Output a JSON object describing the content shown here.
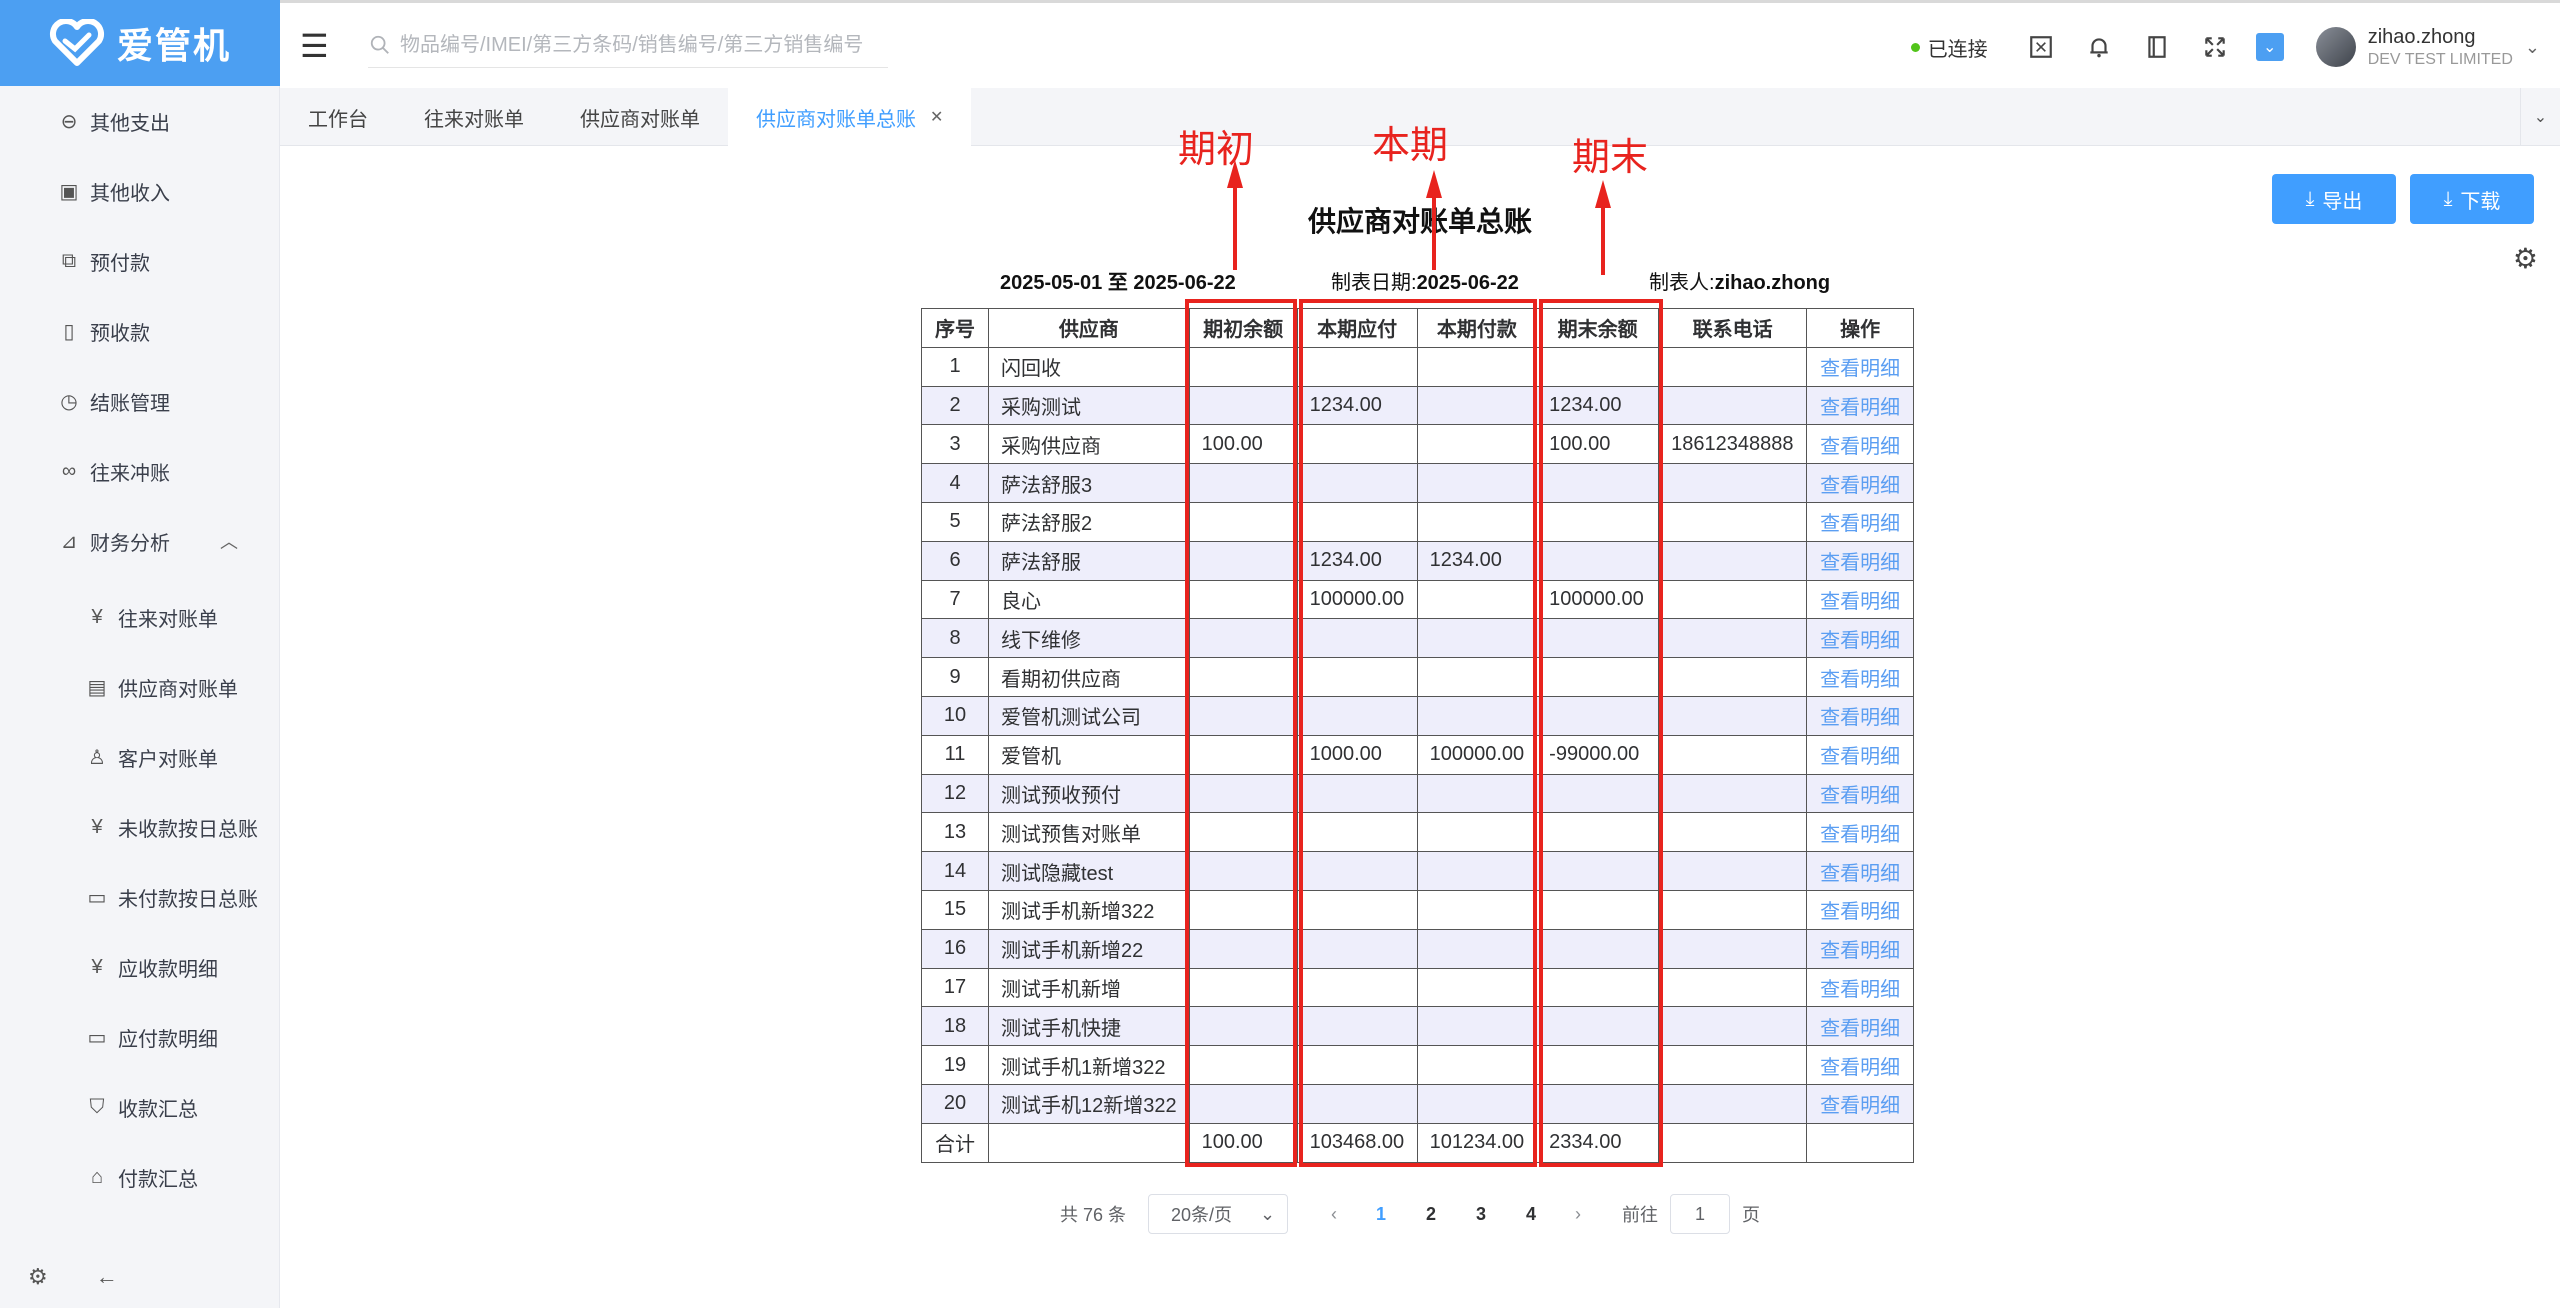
{
  "app": {
    "name": "爱管机"
  },
  "sidebar": {
    "items": [
      {
        "label": "其他支出",
        "icon": "coin-circle-icon"
      },
      {
        "label": "其他收入",
        "icon": "income-receipt-icon"
      },
      {
        "label": "预付款",
        "icon": "prepay-icon"
      },
      {
        "label": "预收款",
        "icon": "document-icon"
      },
      {
        "label": "结账管理",
        "icon": "history-clock-icon"
      },
      {
        "label": "往来冲账",
        "icon": "link-icon"
      },
      {
        "label": "财务分析",
        "icon": "chart-icon",
        "expanded": true
      }
    ],
    "subitems": [
      {
        "label": "往来对账单",
        "icon": "yen-doc-icon"
      },
      {
        "label": "供应商对账单",
        "icon": "doc-list-icon"
      },
      {
        "label": "客户对账单",
        "icon": "user-doc-icon"
      },
      {
        "label": "未收款按日总账",
        "icon": "yen-doc-icon"
      },
      {
        "label": "未付款按日总账",
        "icon": "wallet-icon"
      },
      {
        "label": "应收款明细",
        "icon": "yen-doc-icon"
      },
      {
        "label": "应付款明细",
        "icon": "card-icon"
      },
      {
        "label": "收款汇总",
        "icon": "shield-yen-icon"
      },
      {
        "label": "付款汇总",
        "icon": "home-yen-icon"
      }
    ]
  },
  "header": {
    "search_placeholder": "物品编号/IMEI/第三方条码/销售编号/第三方销售编号",
    "status": "已连接",
    "user_name": "zihao.zhong",
    "company": "DEV TEST LIMITED"
  },
  "tabs": [
    {
      "label": "工作台",
      "active": false
    },
    {
      "label": "往来对账单",
      "active": false
    },
    {
      "label": "供应商对账单",
      "active": false
    },
    {
      "label": "供应商对账单总账",
      "active": true
    }
  ],
  "toolbar": {
    "export_label": "导出",
    "download_label": "下载"
  },
  "report": {
    "title": "供应商对账单总账",
    "date_range": "2025-05-01 至 2025-06-22",
    "made_date_label": "制表日期:",
    "made_date": "2025-06-22",
    "maker_label": "制表人:",
    "maker": "zihao.zhong",
    "columns": [
      "序号",
      "供应商",
      "期初余额",
      "本期应付",
      "本期付款",
      "期末余额",
      "联系电话",
      "操作"
    ],
    "rows": [
      [
        "1",
        "闪回收",
        "",
        "",
        "",
        "",
        "",
        "查看明细"
      ],
      [
        "2",
        "采购测试",
        "",
        "1234.00",
        "",
        "1234.00",
        "",
        "查看明细"
      ],
      [
        "3",
        "采购供应商",
        "100.00",
        "",
        "",
        "100.00",
        "18612348888",
        "查看明细"
      ],
      [
        "4",
        "萨法舒服3",
        "",
        "",
        "",
        "",
        "",
        "查看明细"
      ],
      [
        "5",
        "萨法舒服2",
        "",
        "",
        "",
        "",
        "",
        "查看明细"
      ],
      [
        "6",
        "萨法舒服",
        "",
        "1234.00",
        "1234.00",
        "",
        "",
        "查看明细"
      ],
      [
        "7",
        "良心",
        "",
        "100000.00",
        "",
        "100000.00",
        "",
        "查看明细"
      ],
      [
        "8",
        "线下维修",
        "",
        "",
        "",
        "",
        "",
        "查看明细"
      ],
      [
        "9",
        "看期初供应商",
        "",
        "",
        "",
        "",
        "",
        "查看明细"
      ],
      [
        "10",
        "爱管机测试公司",
        "",
        "",
        "",
        "",
        "",
        "查看明细"
      ],
      [
        "11",
        "爱管机",
        "",
        "1000.00",
        "100000.00",
        "-99000.00",
        "",
        "查看明细"
      ],
      [
        "12",
        "测试预收预付",
        "",
        "",
        "",
        "",
        "",
        "查看明细"
      ],
      [
        "13",
        "测试预售对账单",
        "",
        "",
        "",
        "",
        "",
        "查看明细"
      ],
      [
        "14",
        "测试隐藏test",
        "",
        "",
        "",
        "",
        "",
        "查看明细"
      ],
      [
        "15",
        "测试手机新增322",
        "",
        "",
        "",
        "",
        "",
        "查看明细"
      ],
      [
        "16",
        "测试手机新增22",
        "",
        "",
        "",
        "",
        "",
        "查看明细"
      ],
      [
        "17",
        "测试手机新增",
        "",
        "",
        "",
        "",
        "",
        "查看明细"
      ],
      [
        "18",
        "测试手机快捷",
        "",
        "",
        "",
        "",
        "",
        "查看明细"
      ],
      [
        "19",
        "测试手机1新增322",
        "",
        "",
        "",
        "",
        "",
        "查看明细"
      ],
      [
        "20",
        "测试手机12新增322",
        "",
        "",
        "",
        "",
        "",
        "查看明细"
      ]
    ],
    "total": [
      "合计",
      "",
      "100.00",
      "103468.00",
      "101234.00",
      "2334.00",
      "",
      ""
    ]
  },
  "pagination": {
    "total_text": "共 76 条",
    "page_size": "20条/页",
    "pages": [
      "1",
      "2",
      "3",
      "4"
    ],
    "current": "1",
    "goto_label": "前往",
    "goto_value": "1",
    "page_unit": "页"
  },
  "annotations": {
    "opening": "期初",
    "current": "本期",
    "closing": "期末",
    "color": "#e8231e"
  }
}
